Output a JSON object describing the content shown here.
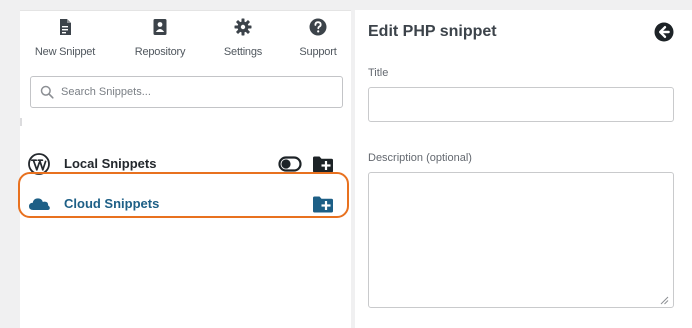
{
  "toolbar": {
    "items": [
      {
        "label": "New Snippet",
        "icon": "file-icon"
      },
      {
        "label": "Repository",
        "icon": "repository-icon"
      },
      {
        "label": "Settings",
        "icon": "gear-icon"
      },
      {
        "label": "Support",
        "icon": "help-icon"
      }
    ]
  },
  "search": {
    "placeholder": "Search Snippets...",
    "value": ""
  },
  "snippet_groups": [
    {
      "label": "Local Snippets",
      "icon": "wordpress-icon",
      "actions": [
        "toggle-icon",
        "add-folder-icon"
      ]
    },
    {
      "label": "Cloud Snippets",
      "icon": "cloud-icon",
      "actions": [
        "add-folder-icon"
      ],
      "highlighted": true
    }
  ],
  "editor": {
    "title": "Edit PHP snippet",
    "back_icon": "back-arrow-icon",
    "title_label": "Title",
    "title_value": "",
    "description_label": "Description (optional)",
    "description_value": ""
  },
  "colors": {
    "highlight": "#e8711f",
    "cloud_accent": "#1d5f86",
    "icon_dark": "#1d2327",
    "background": "#f0f0f1"
  }
}
